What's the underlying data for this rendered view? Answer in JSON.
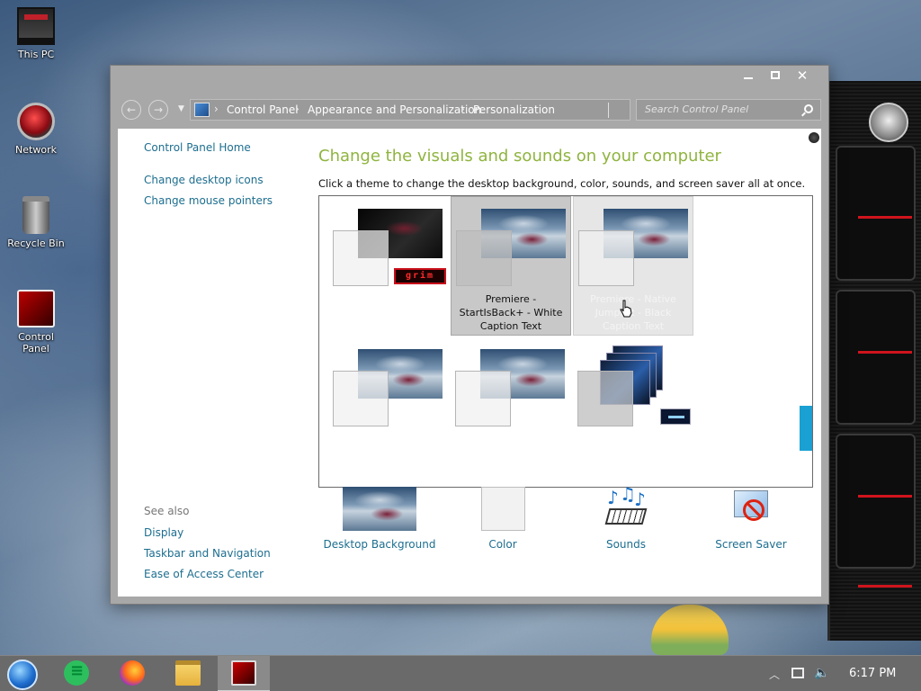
{
  "desktop": {
    "icons": [
      {
        "label": "This PC"
      },
      {
        "label": "Network"
      },
      {
        "label": "Recycle Bin"
      },
      {
        "label": "Control Panel"
      }
    ]
  },
  "window": {
    "address": {
      "crumbs": [
        "Control Panel",
        "Appearance and Personalization",
        "Personalization"
      ]
    },
    "search": {
      "placeholder": "Search Control Panel"
    },
    "sidebar": {
      "links": [
        "Control Panel Home",
        "Change desktop icons",
        "Change mouse pointers"
      ],
      "see_also_title": "See also",
      "see_also": [
        "Display",
        "Taskbar and Navigation",
        "Ease of Access Center"
      ]
    },
    "main": {
      "title": "Change the visuals and sounds on your computer",
      "subtitle": "Click a theme to change the desktop background, color, sounds, and screen saver all at once.",
      "themes": [
        {
          "label": "",
          "badge": "grim",
          "state": "normal"
        },
        {
          "label": "Premiere - StartIsBack+ - White Caption Text",
          "state": "selected"
        },
        {
          "label": "Premiere - Native Jumplist - Black Caption Text",
          "state": "hover"
        },
        {
          "label": "",
          "state": "normal"
        },
        {
          "label": "",
          "state": "normal"
        },
        {
          "label": "",
          "state": "normal"
        }
      ],
      "options": [
        {
          "label": "Desktop Background"
        },
        {
          "label": "Color"
        },
        {
          "label": "Sounds"
        },
        {
          "label": "Screen Saver"
        }
      ]
    }
  },
  "taskbar": {
    "items": [
      "start",
      "notes",
      "firefox",
      "file-explorer",
      "control-panel"
    ],
    "clock": "6:17 PM"
  },
  "colors": {
    "accent_link": "#1d6e8f",
    "heading": "#8fb43f",
    "scroll_indicator": "#1aa0d2"
  }
}
